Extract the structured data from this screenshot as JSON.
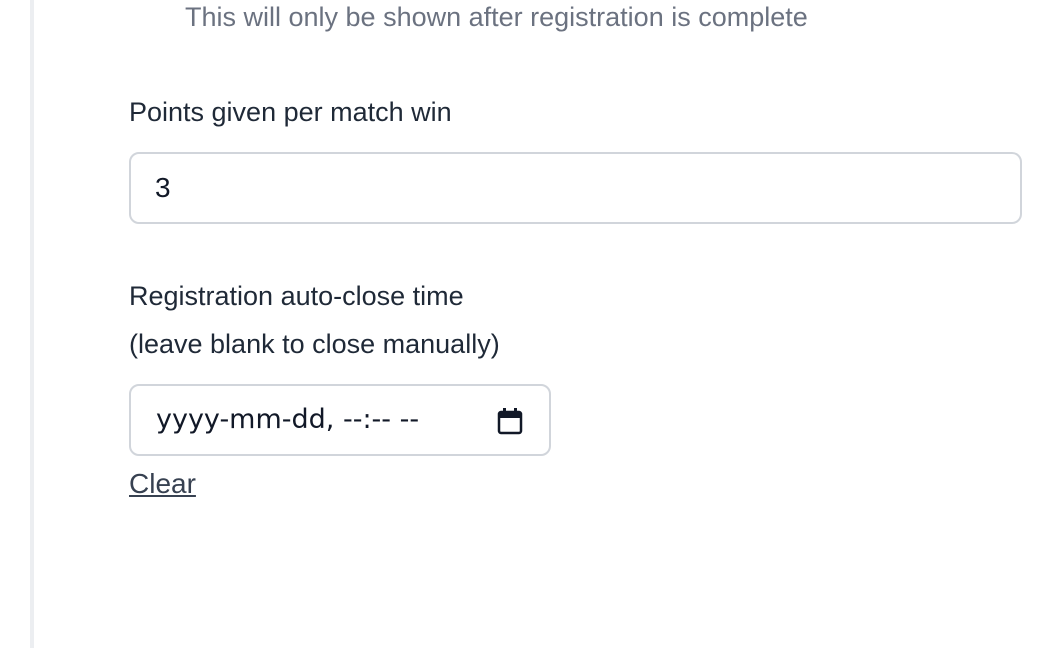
{
  "helper": {
    "text": "This will only be shown after registration is complete"
  },
  "points_field": {
    "label": "Points given per match win",
    "value": "3"
  },
  "auto_close_field": {
    "label_line1": "Registration auto-close time",
    "label_line2": "(leave blank to close manually)",
    "placeholder": "yyyy-mm-dd, --:-- --",
    "icon": "calendar-icon"
  },
  "clear_link": {
    "label": "Clear"
  },
  "colors": {
    "label_text": "#1f2937",
    "helper_text": "#6b7280",
    "input_border": "#d1d5db"
  }
}
